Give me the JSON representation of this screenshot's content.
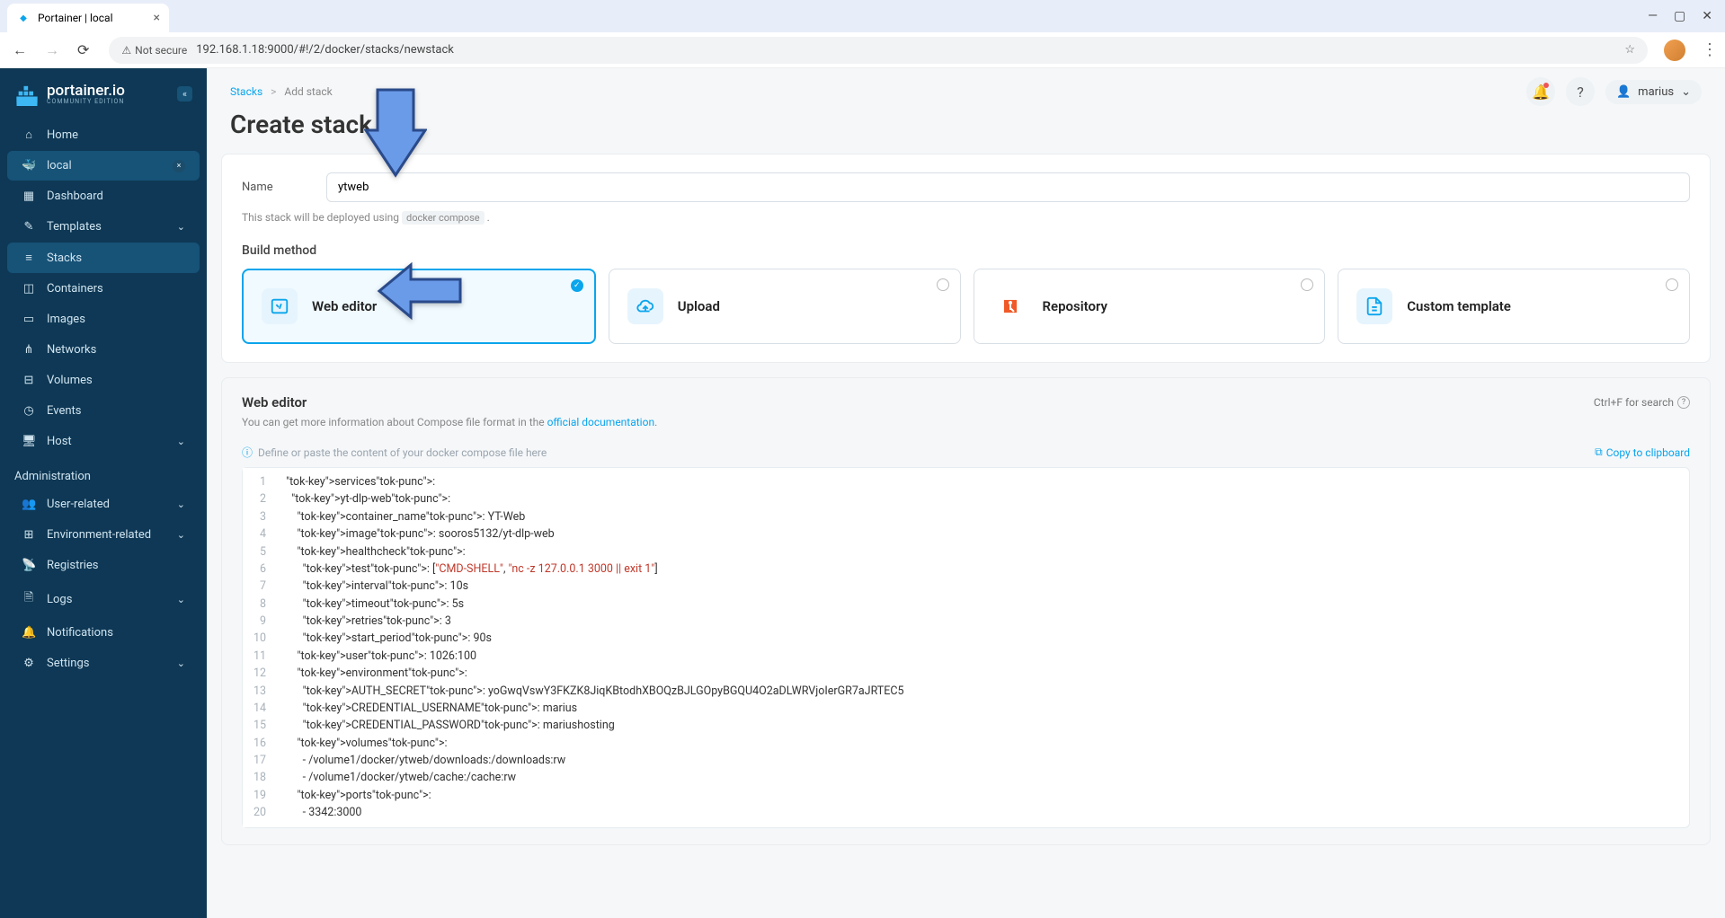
{
  "browser": {
    "tab_title": "Portainer | local",
    "url": "192.168.1.18:9000/#!/2/docker/stacks/newstack",
    "not_secure": "Not secure"
  },
  "sidebar": {
    "logo": "portainer.io",
    "edition": "COMMUNITY EDITION",
    "items": [
      {
        "icon": "⌂",
        "label": "Home"
      },
      {
        "icon": "🐳",
        "label": "local",
        "active_env": true
      },
      {
        "icon": "▦",
        "label": "Dashboard"
      },
      {
        "icon": "✎",
        "label": "Templates",
        "chev": true
      },
      {
        "icon": "≡",
        "label": "Stacks",
        "active": true
      },
      {
        "icon": "◫",
        "label": "Containers"
      },
      {
        "icon": "▭",
        "label": "Images"
      },
      {
        "icon": "⋔",
        "label": "Networks"
      },
      {
        "icon": "⊟",
        "label": "Volumes"
      },
      {
        "icon": "◷",
        "label": "Events"
      },
      {
        "icon": "🖥",
        "label": "Host",
        "chev": true
      }
    ],
    "admin_label": "Administration",
    "admin_items": [
      {
        "icon": "👥",
        "label": "User-related",
        "chev": true
      },
      {
        "icon": "⊞",
        "label": "Environment-related",
        "chev": true
      },
      {
        "icon": "📡",
        "label": "Registries"
      },
      {
        "icon": "🗎",
        "label": "Logs",
        "chev": true
      },
      {
        "icon": "🔔",
        "label": "Notifications"
      },
      {
        "icon": "⚙",
        "label": "Settings",
        "chev": true
      }
    ]
  },
  "breadcrumb": {
    "root": "Stacks",
    "sep": ">",
    "current": "Add stack"
  },
  "header": {
    "title": "Create stack",
    "user": "marius"
  },
  "form": {
    "name_label": "Name",
    "name_value": "ytweb",
    "hint_pre": "This stack will be deployed using ",
    "hint_code": "docker compose",
    "hint_post": " .",
    "build_method": "Build method"
  },
  "methods": [
    {
      "label": "Web editor",
      "selected": true
    },
    {
      "label": "Upload"
    },
    {
      "label": "Repository"
    },
    {
      "label": "Custom template"
    }
  ],
  "editor": {
    "title": "Web editor",
    "search_hint": "Ctrl+F for search",
    "desc_pre": "You can get more information about Compose file format in the ",
    "desc_link": "official documentation",
    "desc_post": ".",
    "placeholder_hint": "Define or paste the content of your docker compose file here",
    "copy": "Copy to clipboard"
  },
  "code_lines": [
    "services:",
    "  yt-dlp-web:",
    "    container_name: YT-Web",
    "    image: sooros5132/yt-dlp-web",
    "    healthcheck:",
    "      test: [\"CMD-SHELL\", \"nc -z 127.0.0.1 3000 || exit 1\"]",
    "      interval: 10s",
    "      timeout: 5s",
    "      retries: 3",
    "      start_period: 90s",
    "    user: 1026:100",
    "    environment:",
    "      AUTH_SECRET: yoGwqVswY3FKZK8JiqKBtodhXBOQzBJLGOpyBGQU4O2aDLWRVjoIerGR7aJRTEC5",
    "      CREDENTIAL_USERNAME: marius",
    "      CREDENTIAL_PASSWORD: mariushosting",
    "    volumes:",
    "      - /volume1/docker/ytweb/downloads:/downloads:rw",
    "      - /volume1/docker/ytweb/cache:/cache:rw",
    "    ports:",
    "      - 3342:3000"
  ]
}
